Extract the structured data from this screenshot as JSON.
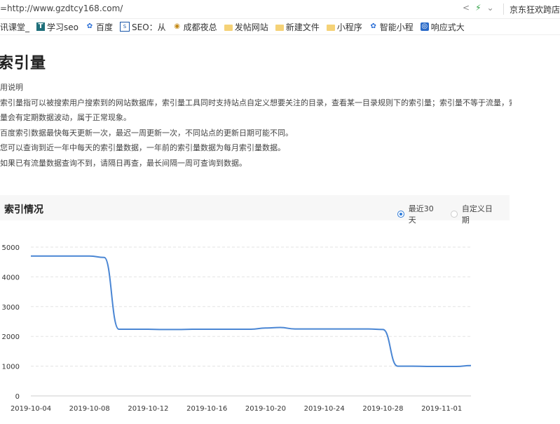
{
  "browser": {
    "url": "=http://www.gzdtcy168.com/",
    "right_link": "京东狂欢跨店",
    "share_icon": "share-icon",
    "bolt_icon": "bolt-icon",
    "chevron_icon": "chevron-down-icon"
  },
  "bookmarks": [
    {
      "label": "腾讯课堂_",
      "icon": "none"
    },
    {
      "label": "学习seo",
      "icon": "t-icon"
    },
    {
      "label": "百度",
      "icon": "paw-icon"
    },
    {
      "label": "SEO：从",
      "icon": "seo-icon"
    },
    {
      "label": "成都夜总",
      "icon": "cd-icon"
    },
    {
      "label": "发帖网站",
      "icon": "folder-icon"
    },
    {
      "label": "新建文件",
      "icon": "folder-icon"
    },
    {
      "label": "小程序",
      "icon": "folder-icon"
    },
    {
      "label": "智能小程",
      "icon": "paw-icon"
    },
    {
      "label": "响应式大",
      "icon": "resp-icon"
    }
  ],
  "page": {
    "title": "索引量",
    "desc_heading": "用说明",
    "desc_lines": [
      "索引量指可以被搜索用户搜索到的网站数据库，索引量工具同时支持站点自定义想要关注的目录，查看某一目录规则下的索引量；索引量不等于流量，索",
      "量会有定期数据波动，属于正常现象。",
      "百度索引数据最快每天更新一次，最迟一周更新一次，不同站点的更新日期可能不同。",
      "您可以查询到近一年中每天的索引量数据，一年前的索引量数据为每月索引量数据。",
      "如果已有流量数据查询不到，请隔日再查，最长间隔一周可查询到数据。"
    ]
  },
  "panel": {
    "title": "索引情况",
    "radio_recent": "最近30天",
    "radio_custom": "自定义日期",
    "selected": "recent"
  },
  "chart_data": {
    "type": "line",
    "title": "",
    "xlabel": "",
    "ylabel": "",
    "ylim": [
      0,
      5000
    ],
    "yticks": [
      0,
      1000,
      2000,
      3000,
      4000,
      5000
    ],
    "grid": "horizontal dashed",
    "line_color": "#4a86d4",
    "x_tick_labels": [
      "2019-10-04",
      "2019-10-08",
      "2019-10-12",
      "2019-10-16",
      "2019-10-20",
      "2019-10-24",
      "2019-10-28",
      "2019-11-01"
    ],
    "series": [
      {
        "x": [
          "2019-10-04",
          "2019-10-05",
          "2019-10-06",
          "2019-10-07",
          "2019-10-08",
          "2019-10-09",
          "2019-10-10",
          "2019-10-11",
          "2019-10-12",
          "2019-10-13",
          "2019-10-14",
          "2019-10-15",
          "2019-10-16",
          "2019-10-17",
          "2019-10-18",
          "2019-10-19",
          "2019-10-20",
          "2019-10-21",
          "2019-10-22",
          "2019-10-23",
          "2019-10-24",
          "2019-10-25",
          "2019-10-26",
          "2019-10-27",
          "2019-10-28",
          "2019-10-29",
          "2019-10-30",
          "2019-10-31",
          "2019-11-01",
          "2019-11-02",
          "2019-11-03"
        ],
        "values": [
          4700,
          4700,
          4700,
          4700,
          4700,
          4650,
          2240,
          2240,
          2240,
          2230,
          2230,
          2240,
          2240,
          2240,
          2240,
          2240,
          2280,
          2300,
          2250,
          2250,
          2250,
          2250,
          2250,
          2250,
          2230,
          1000,
          1000,
          990,
          990,
          990,
          1020
        ]
      }
    ]
  }
}
